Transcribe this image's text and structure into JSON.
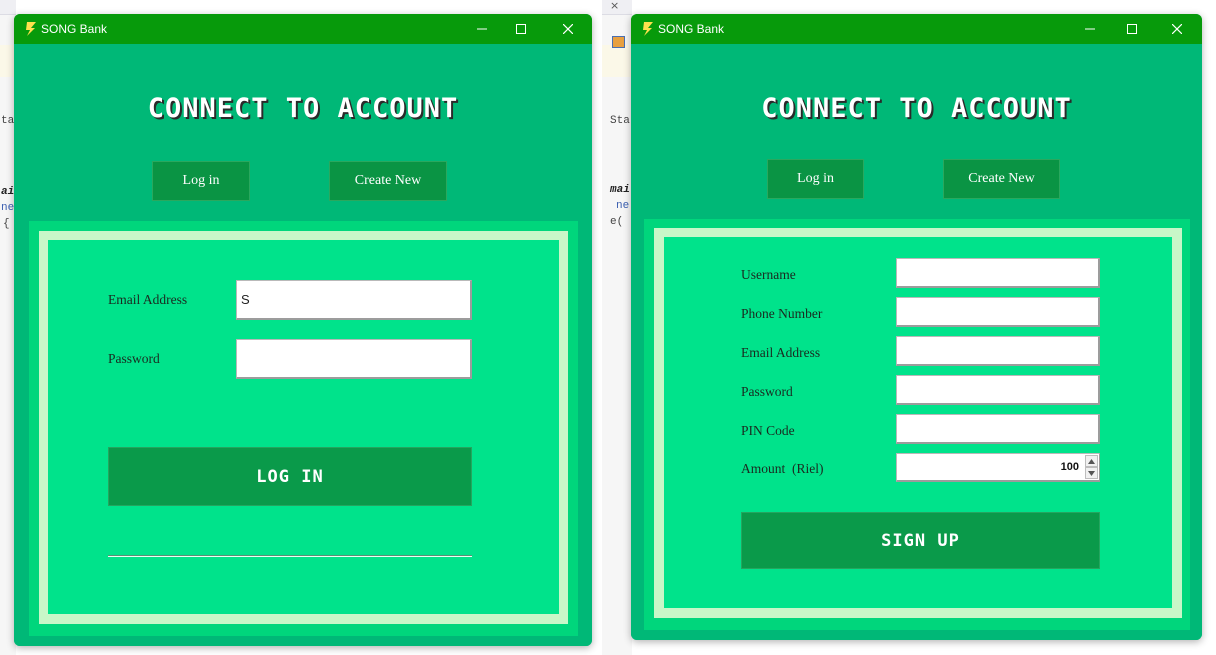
{
  "ide_background": {
    "left_fragments": [
      "ta",
      "ai",
      "ne",
      "{"
    ],
    "right_fragments": [
      "Sta",
      "mai",
      "ne",
      "e("
    ]
  },
  "windows": [
    {
      "app_title": "SONG Bank",
      "header_title": "CONNECT TO ACCOUNT",
      "login_tab_label": "Log in",
      "create_tab_label": "Create New",
      "fields": [
        {
          "label": "Email Address",
          "value": "S",
          "placeholder": ""
        },
        {
          "label": "Password",
          "value": "",
          "placeholder": ""
        }
      ],
      "action_label": "LOG IN"
    },
    {
      "app_title": "SONG Bank",
      "header_title": "CONNECT TO ACCOUNT",
      "login_tab_label": "Log in",
      "create_tab_label": "Create New",
      "fields": [
        {
          "label": "Username",
          "value": "",
          "placeholder": ""
        },
        {
          "label": "Phone Number",
          "value": "",
          "placeholder": ""
        },
        {
          "label": "Email Address",
          "value": "",
          "placeholder": ""
        },
        {
          "label": "Password",
          "value": "",
          "placeholder": ""
        },
        {
          "label": "PIN Code",
          "value": "",
          "placeholder": ""
        }
      ],
      "amount": {
        "label": "Amount  (Riel)",
        "value": "100"
      },
      "action_label": "SIGN UP"
    }
  ],
  "colors": {
    "titlebar": "#079a0b",
    "window_body": "#00b877",
    "panel_outer": "#00d67c",
    "panel_border": "#c8f7c8",
    "panel_inner": "#00e38b",
    "button": "#0a9a4a"
  },
  "icons": {
    "app": "song-bank-logo-icon",
    "minimize": "minimize-icon",
    "maximize": "maximize-icon",
    "close": "close-icon",
    "spin_up": "spinner-up-arrow-icon",
    "spin_down": "spinner-down-arrow-icon"
  }
}
